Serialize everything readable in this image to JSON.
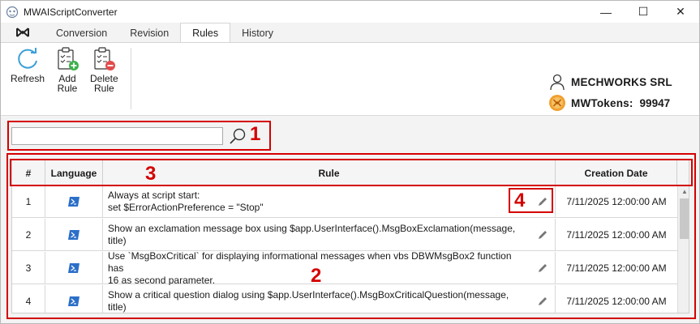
{
  "window": {
    "title": "MWAIScriptConverter",
    "controls": {
      "minimize": "—",
      "maximize": "☐",
      "close": "✕"
    }
  },
  "tabs": [
    {
      "label": "Conversion",
      "active": false
    },
    {
      "label": "Revision",
      "active": false
    },
    {
      "label": "Rules",
      "active": true
    },
    {
      "label": "History",
      "active": false
    }
  ],
  "ribbon": {
    "refresh": {
      "line1": "Refresh",
      "line2": ""
    },
    "add_rule": {
      "line1": "Add",
      "line2": "Rule"
    },
    "delete_rule": {
      "line1": "Delete",
      "line2": "Rule"
    }
  },
  "user": {
    "company": "MECHWORKS SRL",
    "tokens_label": "MWTokens:",
    "tokens_value": "99947"
  },
  "search": {
    "value": "",
    "placeholder": ""
  },
  "callouts": {
    "c1": "1",
    "c2": "2",
    "c3": "3",
    "c4": "4"
  },
  "grid": {
    "columns": {
      "num": "#",
      "language": "Language",
      "rule": "Rule",
      "date": "Creation Date"
    },
    "rows": [
      {
        "num": "1",
        "rule_line1": "Always at script start:",
        "rule_line2": "set $ErrorActionPreference = \"Stop\"",
        "date": "7/11/2025 12:00:00 AM"
      },
      {
        "num": "2",
        "rule_line1": "Show an exclamation message box using $app.UserInterface().MsgBoxExclamation(message, title)",
        "rule_line2": "",
        "date": "7/11/2025 12:00:00 AM"
      },
      {
        "num": "3",
        "rule_line1": "Use `MsgBoxCritical` for displaying informational messages when vbs DBWMsgBox2 function has",
        "rule_line2": "16 as second parameter.",
        "date": "7/11/2025 12:00:00 AM"
      },
      {
        "num": "4",
        "rule_line1": "Show a critical question dialog using $app.UserInterface().MsgBoxCriticalQuestion(message, title)",
        "rule_line2": "",
        "date": "7/11/2025 12:00:00 AM"
      }
    ]
  },
  "colors": {
    "accent": "#d40000",
    "ps_blue": "#2b6fc9",
    "token_orange": "#f0a030"
  }
}
